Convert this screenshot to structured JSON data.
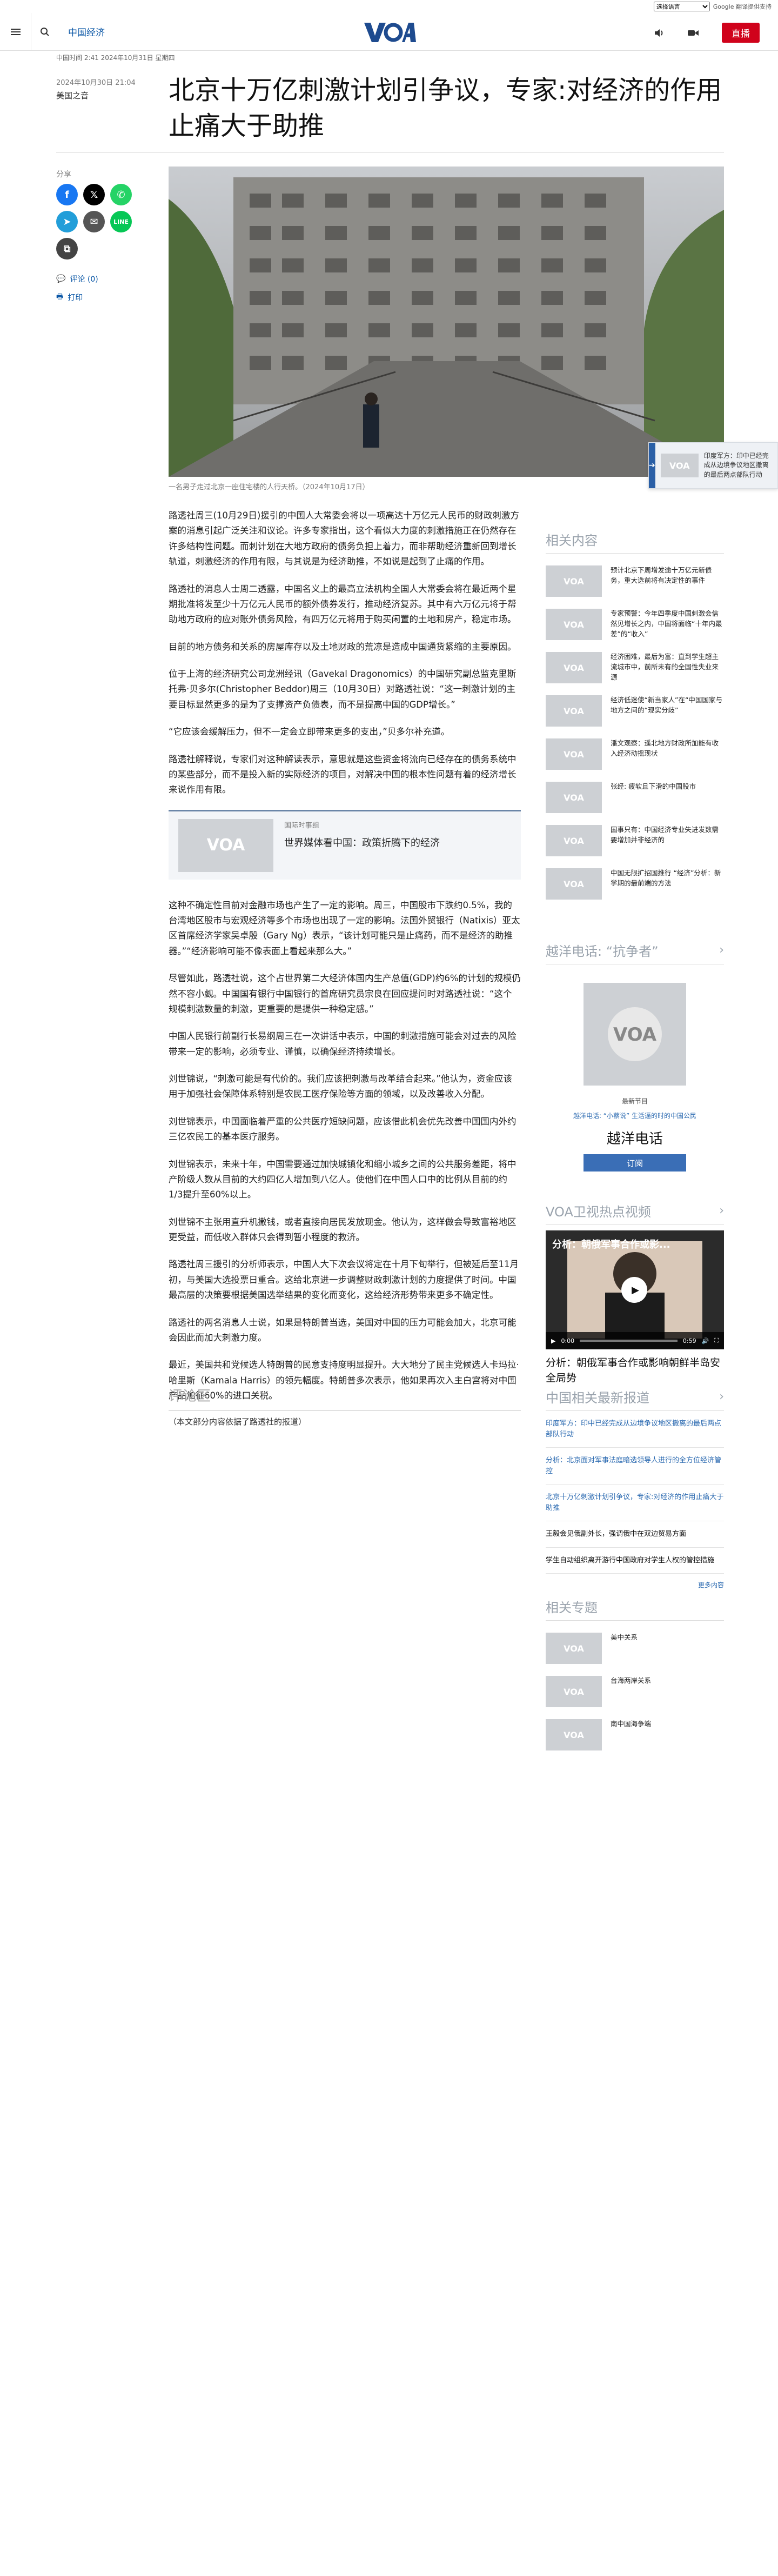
{
  "translate": {
    "select_value": "选择语言",
    "powered": "Google 翻译提供支持"
  },
  "header": {
    "section": "中国经济",
    "live_label": "直播"
  },
  "article": {
    "meta_line": "中国时间 2:41 2024年10月31日 星期四",
    "date": "2024年10月30日 21:04",
    "author": "美国之音",
    "title": "北京十万亿刺激计划引争议，专家:对经济的作用止痛大于助推",
    "share_label": "分享",
    "comments_link": "评论 (0)",
    "print_link": "打印",
    "caption": "一名男子走过北京一座住宅楼的人行天桥。（2024年10月17日）",
    "paragraphs": [
      "路透社周三(10月29日)援引的中国人大常委会将以一项高达十万亿元人民币的财政刺激方案的消息引起广泛关注和议论。许多专家指出，这个看似大力度的刺激措施正在仍然存在许多结构性问题。而刺计划在大地方政府的债务负担上着力，而非帮助经济重新回到增长轨道，刺激经济的作用有限，与其说是为经济助推，不如说是起到了止痛的作用。",
      "路透社的消息人士周二透露，中国名义上的最高立法机构全国人大常委会将在最近两个星期批准将发至少十万亿元人民币的额外债券发行，推动经济复苏。其中有六万亿元将于帮助地方政府的应对账外债务风险，有四万亿元将用于购买闲置的土地和房产，稳定市场。",
      "目前的地方债务和关系的房屋库存以及土地财政的荒凉是造成中国通货紧缩的主要原因。",
      "位于上海的经济研究公司龙洲经讯（Gavekal Dragonomics）的中国研究副总监克里斯托弗·贝多尔(Christopher Beddor)周三（10月30日）对路透社说：“这一刺激计划的主要目标显然更多的是为了支撑资产负债表，而不是提高中国的GDP增长。”",
      "“它应该会缓解压力，但不一定会立即带来更多的支出，”贝多尔补充道。",
      "路透社解释说，专家们对这种解读表示，意思就是这些资金将流向已经存在的债务系统中的某些部分，而不是投入新的实际经济的项目，对解决中国的根本性问题有着的经济增长来说作用有限。"
    ],
    "related_card": {
      "label": "国际时事组",
      "title": "世界媒体看中国：政策折腾下的经济"
    },
    "paragraphs2": [
      "这种不确定性目前对金融市场也产生了一定的影响。周三，中国股市下跌约0.5%，我的台湾地区股市与宏观经济等多个市场也出现了一定的影响。法国外贸银行（Natixis）亚太区首席经济学家吴卓殷（Gary Ng）表示，“该计划可能只是止痛药，而不是经济的助推器。”“经济影响可能不像表面上看起来那么大。”",
      "尽管如此，路透社说，这个占世界第二大经济体国内生产总值(GDP)约6%的计划的规模仍然不容小觑。中国国有银行中国银行的首席研究员宗良在回应提问时对路透社说：“这个规模刺激数量的刺激，更重要的是提供一种稳定感。”",
      "中国人民银行前副行长易纲周三在一次讲话中表示，中国的刺激措施可能会对过去的风险带来一定的影响，必须专业、谨慎，以确保经济持续增长。",
      "刘世锦说，“刺激可能是有代价的。我们应该把刺激与改革结合起来。”他认为，资金应该用于加强社会保障体系特别是农民工医疗保险等方面的领域，以及改善收入分配。",
      "刘世锦表示，中国面临着严重的公共医疗短缺问题，应该借此机会优先改善中国国内外约三亿农民工的基本医疗服务。",
      "刘世锦表示，未来十年，中国需要通过加快城镇化和缩小城乡之间的公共服务差距，将中产阶级人数从目前的大约四亿人增加到八亿人。使他们在中国人口中的比例从目前的约1/3提升至60%以上。",
      "刘世锦不主张用直升机撒钱，或者直接向居民发放现金。他认为，这样做会导致富裕地区更受益，而低收入群体只会得到暂小程度的救济。",
      "路透社周三援引的分析师表示，中国人大下次会议将定在十月下旬举行，但被延后至11月初，与美国大选投票日重合。这给北京进一步调整财政刺激计划的力度提供了时间。中国最高层的决策要根据美国选举结果的变化而变化，这给经济形势带来更多不确定性。",
      "路透社的两名消息人士说，如果是特朗普当选，美国对中国的压力可能会加大，北京可能会因此而加大刺激力度。",
      "最近，美国共和党候选人特朗普的民意支持度明显提升。大大地分了民主党候选人卡玛拉·哈里斯（Kamala Harris）的领先幅度。特朗普多次表示，他如果再次入主白宫将对中国产品加征60%的进口关税。"
    ],
    "note": "（本文部分内容依据了路透社的报道）",
    "comments_heading": "评论区"
  },
  "sidebar": {
    "popout_text": "印度军方：印中已经完成从边境争议地区撤离的最后两点部队行动",
    "related_heading": "相关内容",
    "related": [
      "预计北京下周增发逾十万亿元新债务，重大选前将有决定性的事件",
      "专家预警：今年四季度中国刺激会信然见增长之内，中国将面临“十年内最差”的“收入”",
      "经济困难，最后为富：直到学生超主流城市中，前所未有的全国性失业来源",
      "经济低迷使“新当家人”在“中国国家与地方之间的“现实分歧”",
      "潘文观察：遥北地方财政所加能有收入经济动摇现状",
      "张经: 疲软且下滑的中国股市",
      "国事只有：中国经济专业失进发数需要增加并非经济的",
      "中国无限扩招国推行 “经济”分析：新学期的最前端的方法"
    ],
    "hotline_heading": "越洋电话: “抗争者”",
    "podcast_label": "最新节目",
    "podcast_link": "越洋电话: “小蔡说” 生活逼的时的中国公民",
    "podcast_title": "越洋电话",
    "subscribe": "订阅",
    "video_heading": "VOA卫视热点视频",
    "video_overlay": "分析：朝俄军事合作或影...",
    "video_time": "0:00",
    "video_duration": "0:59",
    "video_title": "分析：朝俄军事合作或影响朝鲜半岛安全局势",
    "news_heading": "中国相关最新报道",
    "news": [
      "印度军方：印中已经完成从边境争议地区撤离的最后两点部队行动",
      "分析：北京面对军事法庭暗选领导人进行的全方位经济管控",
      "北京十万亿刺激计划引争议，专家:对经济的作用止痛大于助推",
      "王毅会见俄副外长，强调俄中在双边贸易方面",
      "学生自动组织离开游行中国政府对学生人权的管控措施"
    ],
    "more": "更多内容",
    "topics_heading": "相关专题",
    "topics": [
      "美中关系",
      "台海两岸关系",
      "南中国海争端"
    ]
  }
}
